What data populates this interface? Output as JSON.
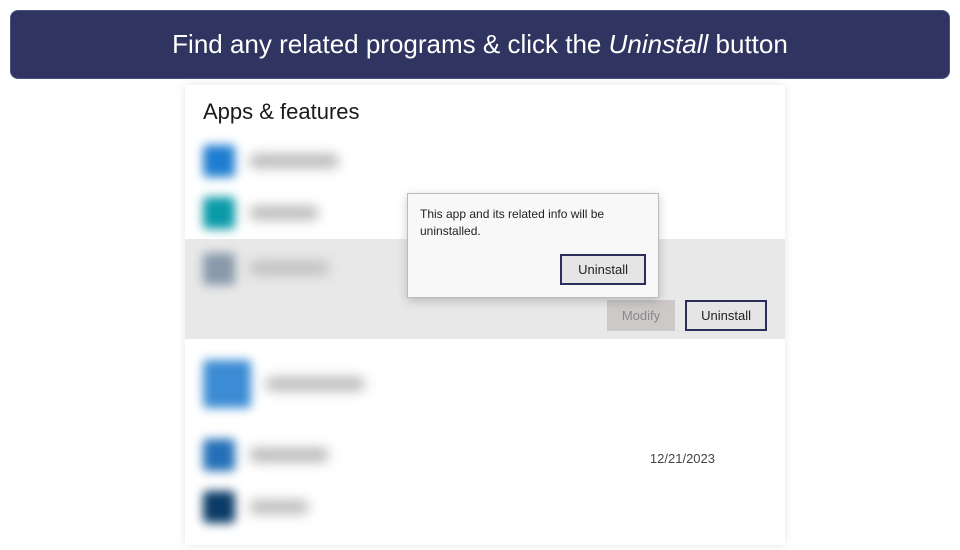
{
  "banner": {
    "prefix": "Find any related programs & click the ",
    "italic": "Uninstall",
    "suffix": " button"
  },
  "page": {
    "title": "Apps & features"
  },
  "popup": {
    "message": "This app and its related info will be uninstalled.",
    "confirm_label": "Uninstall"
  },
  "selected_actions": {
    "modify_label": "Modify",
    "uninstall_label": "Uninstall"
  },
  "items": {
    "row5_date": "12/21/2023"
  }
}
